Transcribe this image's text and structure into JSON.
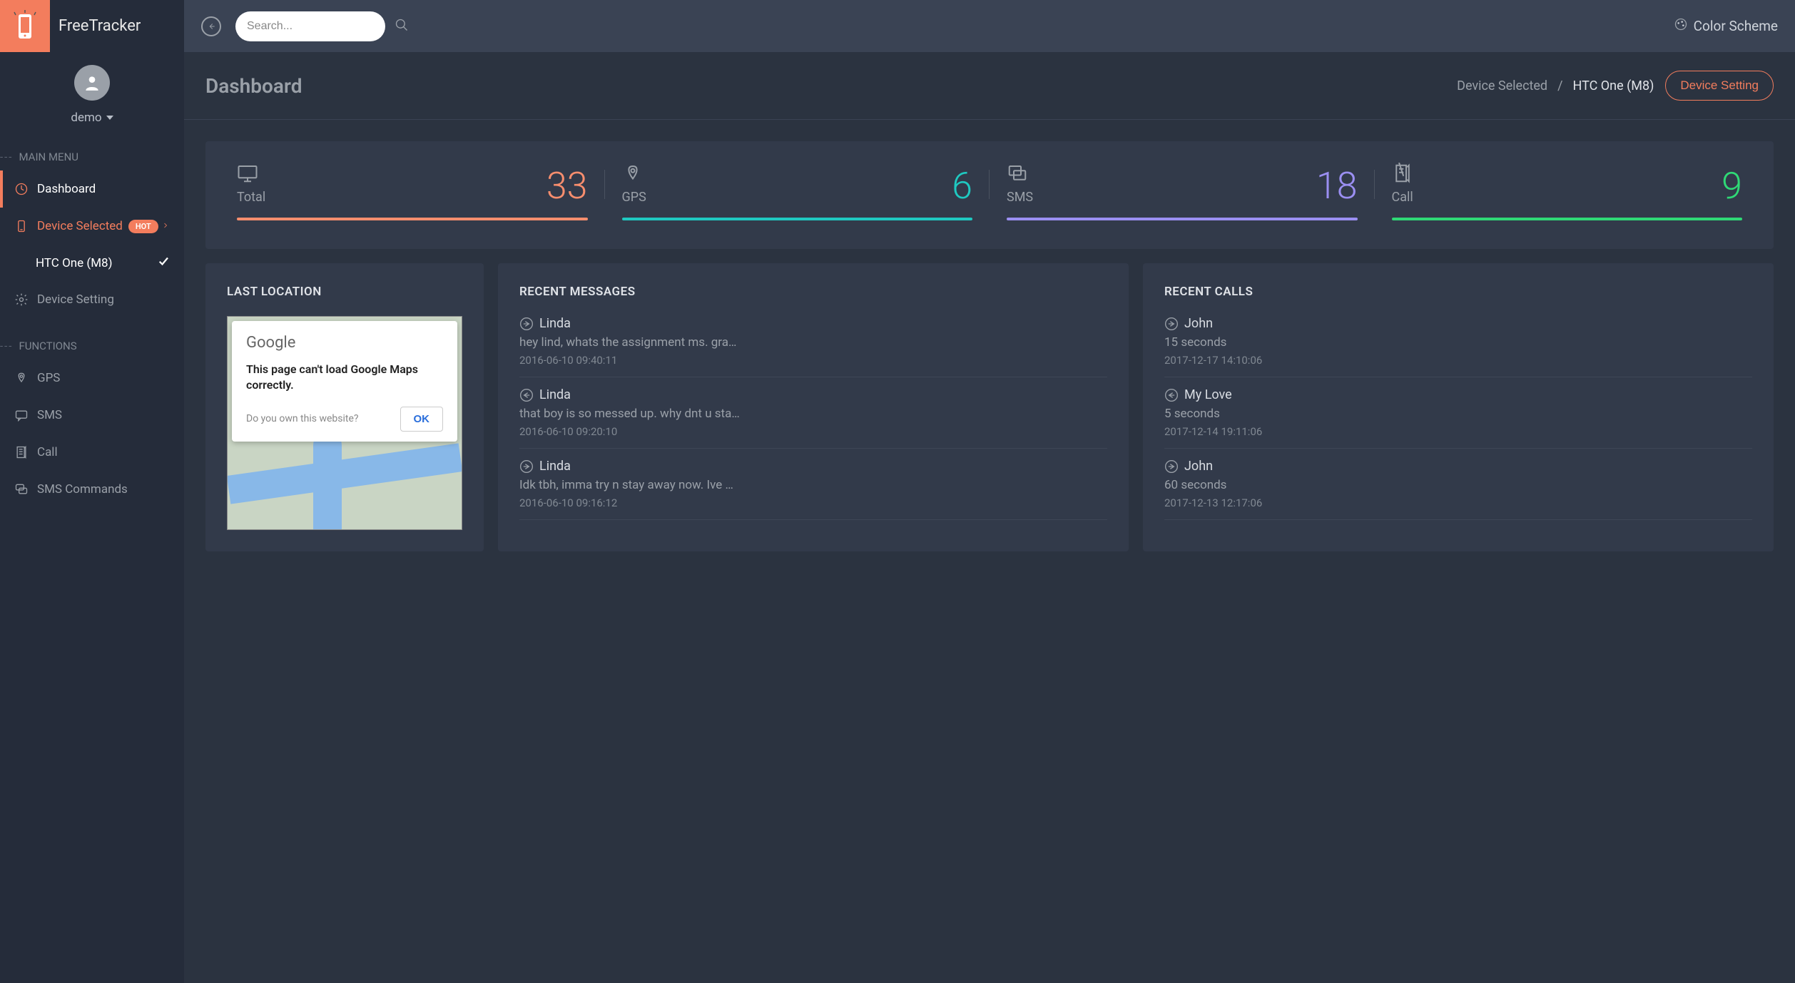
{
  "brand": "FreeTracker",
  "user": {
    "name": "demo"
  },
  "topbar": {
    "search_placeholder": "Search...",
    "color_scheme": "Color Scheme"
  },
  "sidebar": {
    "sections": {
      "main": "MAIN MENU",
      "functions": "FUNCTIONS"
    },
    "dashboard": "Dashboard",
    "device_selected": "Device Selected",
    "device_selected_badge": "HOT",
    "device_name": "HTC One (M8)",
    "device_setting": "Device Setting",
    "gps": "GPS",
    "sms": "SMS",
    "call": "Call",
    "sms_commands": "SMS Commands"
  },
  "page": {
    "title": "Dashboard",
    "breadcrumb_label": "Device Selected",
    "breadcrumb_device": "HTC One (M8)",
    "device_setting_btn": "Device Setting"
  },
  "stats": [
    {
      "label": "Total",
      "value": "33",
      "color": "#f88e6e"
    },
    {
      "label": "GPS",
      "value": "6",
      "color": "#1fc9c1"
    },
    {
      "label": "SMS",
      "value": "18",
      "color": "#9b8ff2"
    },
    {
      "label": "Call",
      "value": "9",
      "color": "#2fd976"
    }
  ],
  "panels": {
    "location_title": "LAST LOCATION",
    "messages_title": "RECENT MESSAGES",
    "calls_title": "RECENT CALLS"
  },
  "map_dialog": {
    "brand": "Google",
    "message": "This page can't load Google Maps correctly.",
    "question": "Do you own this website?",
    "ok": "OK"
  },
  "messages": [
    {
      "name": "Linda",
      "direction": "out",
      "body": "hey lind, whats the assignment ms. gra…",
      "time": "2016-06-10 09:40:11"
    },
    {
      "name": "Linda",
      "direction": "in",
      "body": "that boy is so messed up. why dnt u sta…",
      "time": "2016-06-10 09:20:10"
    },
    {
      "name": "Linda",
      "direction": "out",
      "body": "Idk tbh, imma try n stay away now. Ive …",
      "time": "2016-06-10 09:16:12"
    }
  ],
  "calls": [
    {
      "name": "John",
      "direction": "out",
      "duration": "15 seconds",
      "time": "2017-12-17 14:10:06"
    },
    {
      "name": "My Love",
      "direction": "in",
      "duration": "5 seconds",
      "time": "2017-12-14 19:11:06"
    },
    {
      "name": "John",
      "direction": "out",
      "duration": "60 seconds",
      "time": "2017-12-13 12:17:06"
    }
  ]
}
